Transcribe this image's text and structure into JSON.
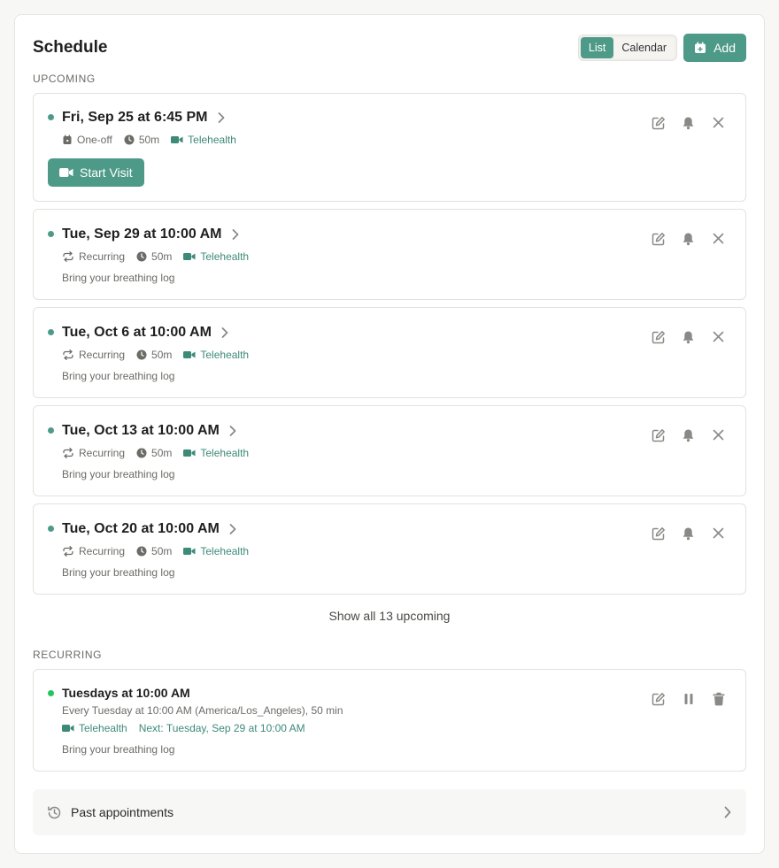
{
  "header": {
    "title": "Schedule",
    "view_list": "List",
    "view_calendar": "Calendar",
    "add_label": "Add"
  },
  "sections": {
    "upcoming": "UPCOMING",
    "recurring": "RECURRING"
  },
  "upcoming": [
    {
      "title": "Fri, Sep 25 at 6:45 PM",
      "type": "One-off",
      "duration": "50m",
      "mode": "Telehealth",
      "note": "",
      "action": "Start Visit"
    },
    {
      "title": "Tue, Sep 29 at 10:00 AM",
      "type": "Recurring",
      "duration": "50m",
      "mode": "Telehealth",
      "note": "Bring your breathing log"
    },
    {
      "title": "Tue, Oct 6 at 10:00 AM",
      "type": "Recurring",
      "duration": "50m",
      "mode": "Telehealth",
      "note": "Bring your breathing log"
    },
    {
      "title": "Tue, Oct 13 at 10:00 AM",
      "type": "Recurring",
      "duration": "50m",
      "mode": "Telehealth",
      "note": "Bring your breathing log"
    },
    {
      "title": "Tue, Oct 20 at 10:00 AM",
      "type": "Recurring",
      "duration": "50m",
      "mode": "Telehealth",
      "note": "Bring your breathing log"
    }
  ],
  "show_all": "Show all 13 upcoming",
  "recurring": {
    "title": "Tuesdays at 10:00 AM",
    "description": "Every Tuesday at 10:00 AM (America/Los_Angeles), 50 min",
    "mode": "Telehealth",
    "next": "Next: Tuesday, Sep 29 at 10:00 AM",
    "note": "Bring your breathing log"
  },
  "past": {
    "label": "Past appointments"
  },
  "colors": {
    "accent": "#4e9a88",
    "status_dot": "#22c55e"
  },
  "icons": {
    "edit": "edit-icon",
    "bell": "bell-icon",
    "close": "close-icon",
    "pause": "pause-icon",
    "trash": "trash-icon",
    "video": "video-icon",
    "clock": "clock-icon",
    "repeat": "repeat-icon",
    "calendar": "calendar-icon",
    "history": "history-icon"
  }
}
